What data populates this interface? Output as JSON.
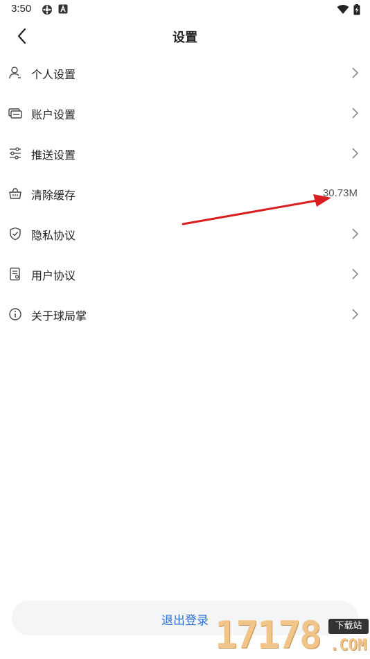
{
  "status_bar": {
    "time": "3:50",
    "icons": [
      "gear-badge-icon",
      "a-badge-icon",
      "wifi-icon",
      "battery-charging-icon"
    ]
  },
  "header": {
    "title": "设置",
    "back_icon": "chevron-left-icon"
  },
  "menu": [
    {
      "label": "个人设置",
      "icon": "user-icon",
      "has_chevron": true
    },
    {
      "label": "账户设置",
      "icon": "card-icon",
      "has_chevron": true
    },
    {
      "label": "推送设置",
      "icon": "sliders-icon",
      "has_chevron": true
    },
    {
      "label": "清除缓存",
      "icon": "basket-icon",
      "value": "30.73M"
    },
    {
      "label": "隐私协议",
      "icon": "shield-check-icon",
      "has_chevron": true
    },
    {
      "label": "用户协议",
      "icon": "document-icon",
      "has_chevron": true
    },
    {
      "label": "关于球局掌",
      "icon": "info-icon",
      "has_chevron": true
    }
  ],
  "logout": {
    "label": "退出登录"
  },
  "watermark": {
    "digits": "17178",
    "badge": "下载站",
    "suffix": ".COM"
  },
  "colors": {
    "accent": "#2a6fd6",
    "arrow": "#d81e1e",
    "button_bg": "#f4f5f7"
  }
}
